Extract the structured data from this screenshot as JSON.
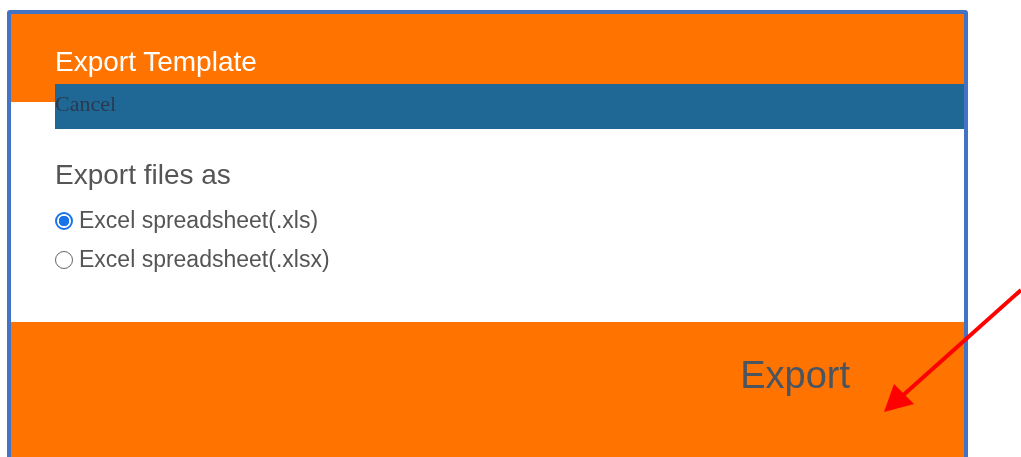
{
  "dialog": {
    "title": "Export Template",
    "cancel_label": "Cancel",
    "section_label": "Export files as",
    "options": [
      {
        "label": "Excel spreadsheet(.xls)",
        "selected": true
      },
      {
        "label": "Excel spreadsheet(.xlsx)",
        "selected": false
      }
    ],
    "export_label": "Export"
  }
}
